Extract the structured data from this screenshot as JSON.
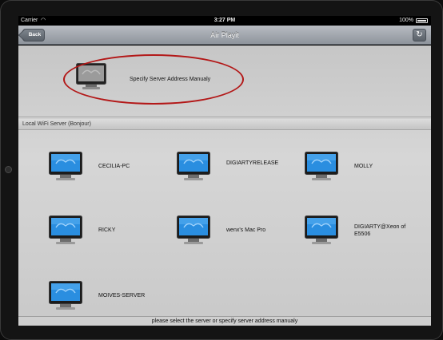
{
  "status_bar": {
    "carrier": "Carrier",
    "wifi_icon": "wifi-icon",
    "time": "3:27 PM",
    "battery": "100%"
  },
  "nav_bar": {
    "back_label": "Back",
    "title": "Air Playit",
    "refresh_icon": "refresh-icon"
  },
  "manual_entry": {
    "label": "Specify Server Address Manualy",
    "highlight_color": "#b31818"
  },
  "section": {
    "header": "Local WiFi Server (Bonjour)"
  },
  "servers": [
    {
      "name": "CECILIA-PC"
    },
    {
      "name": "DIGIARTYRELEASE"
    },
    {
      "name": "MOLLY"
    },
    {
      "name": "RICKY"
    },
    {
      "name": "wenx's Mac Pro"
    },
    {
      "name": "DIGIARTY@Xeon of E5506"
    },
    {
      "name": "MOIVES-SERVER"
    }
  ],
  "footer": {
    "text": "please select the server or specify server address manualy"
  }
}
